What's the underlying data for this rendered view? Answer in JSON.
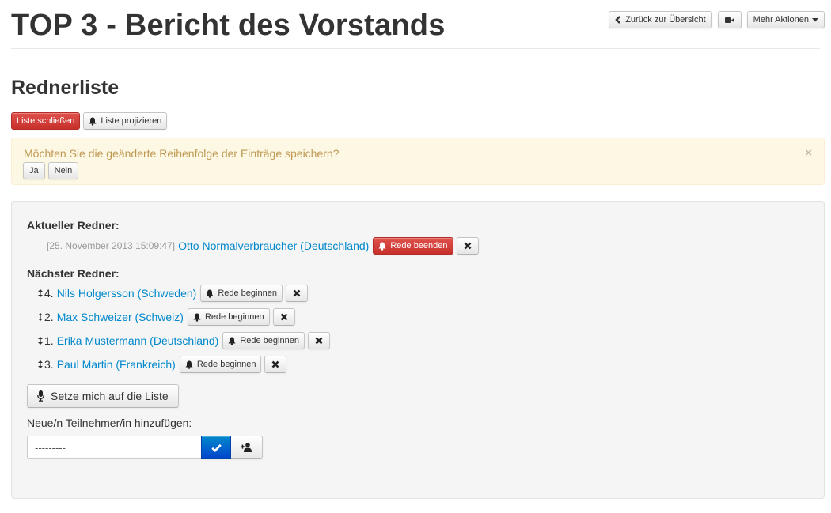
{
  "header": {
    "title": "TOP 3 - Bericht des Vorstands",
    "back_label": "Zurück zur Übersicht",
    "more_actions_label": "Mehr Aktionen"
  },
  "speakers_section": {
    "title": "Rednerliste",
    "close_list_label": "Liste schließen",
    "project_list_label": "Liste projizieren"
  },
  "alert": {
    "message": "Möchten Sie die geänderte Reihenfolge der Einträge speichern?",
    "close": "×",
    "yes_label": "Ja",
    "no_label": "Nein"
  },
  "current_speaker": {
    "heading": "Aktueller Redner:",
    "timestamp": "[25. November 2013 15:09:47]",
    "name": "Otto Normalverbraucher (Deutschland)",
    "end_label": "Rede beenden"
  },
  "next_speakers": {
    "heading": "Nächster Redner:",
    "start_label": "Rede beginnen",
    "items": [
      {
        "number": "4.",
        "name": "Nils Holgersson (Schweden)"
      },
      {
        "number": "2.",
        "name": "Max Schweizer (Schweiz)"
      },
      {
        "number": "1.",
        "name": "Erika Mustermann (Deutschland)"
      },
      {
        "number": "3.",
        "name": "Paul Martin (Frankreich)"
      }
    ]
  },
  "add_self_label": "Setze mich auf die Liste",
  "add_participant": {
    "label": "Neue/n Teilnehmer/in hinzufügen:",
    "value": "---------"
  },
  "colors": {
    "link": "#0088cc",
    "danger": "#c7302b",
    "primary": "#0044cc",
    "alert_bg": "#fcf8e3",
    "alert_text": "#c09853"
  },
  "icons": [
    "chevron-left-icon",
    "video-camera-icon",
    "caret-down-icon",
    "bell-icon",
    "close-icon",
    "drag-vertical-icon",
    "microphone-icon",
    "check-icon",
    "add-user-icon"
  ]
}
